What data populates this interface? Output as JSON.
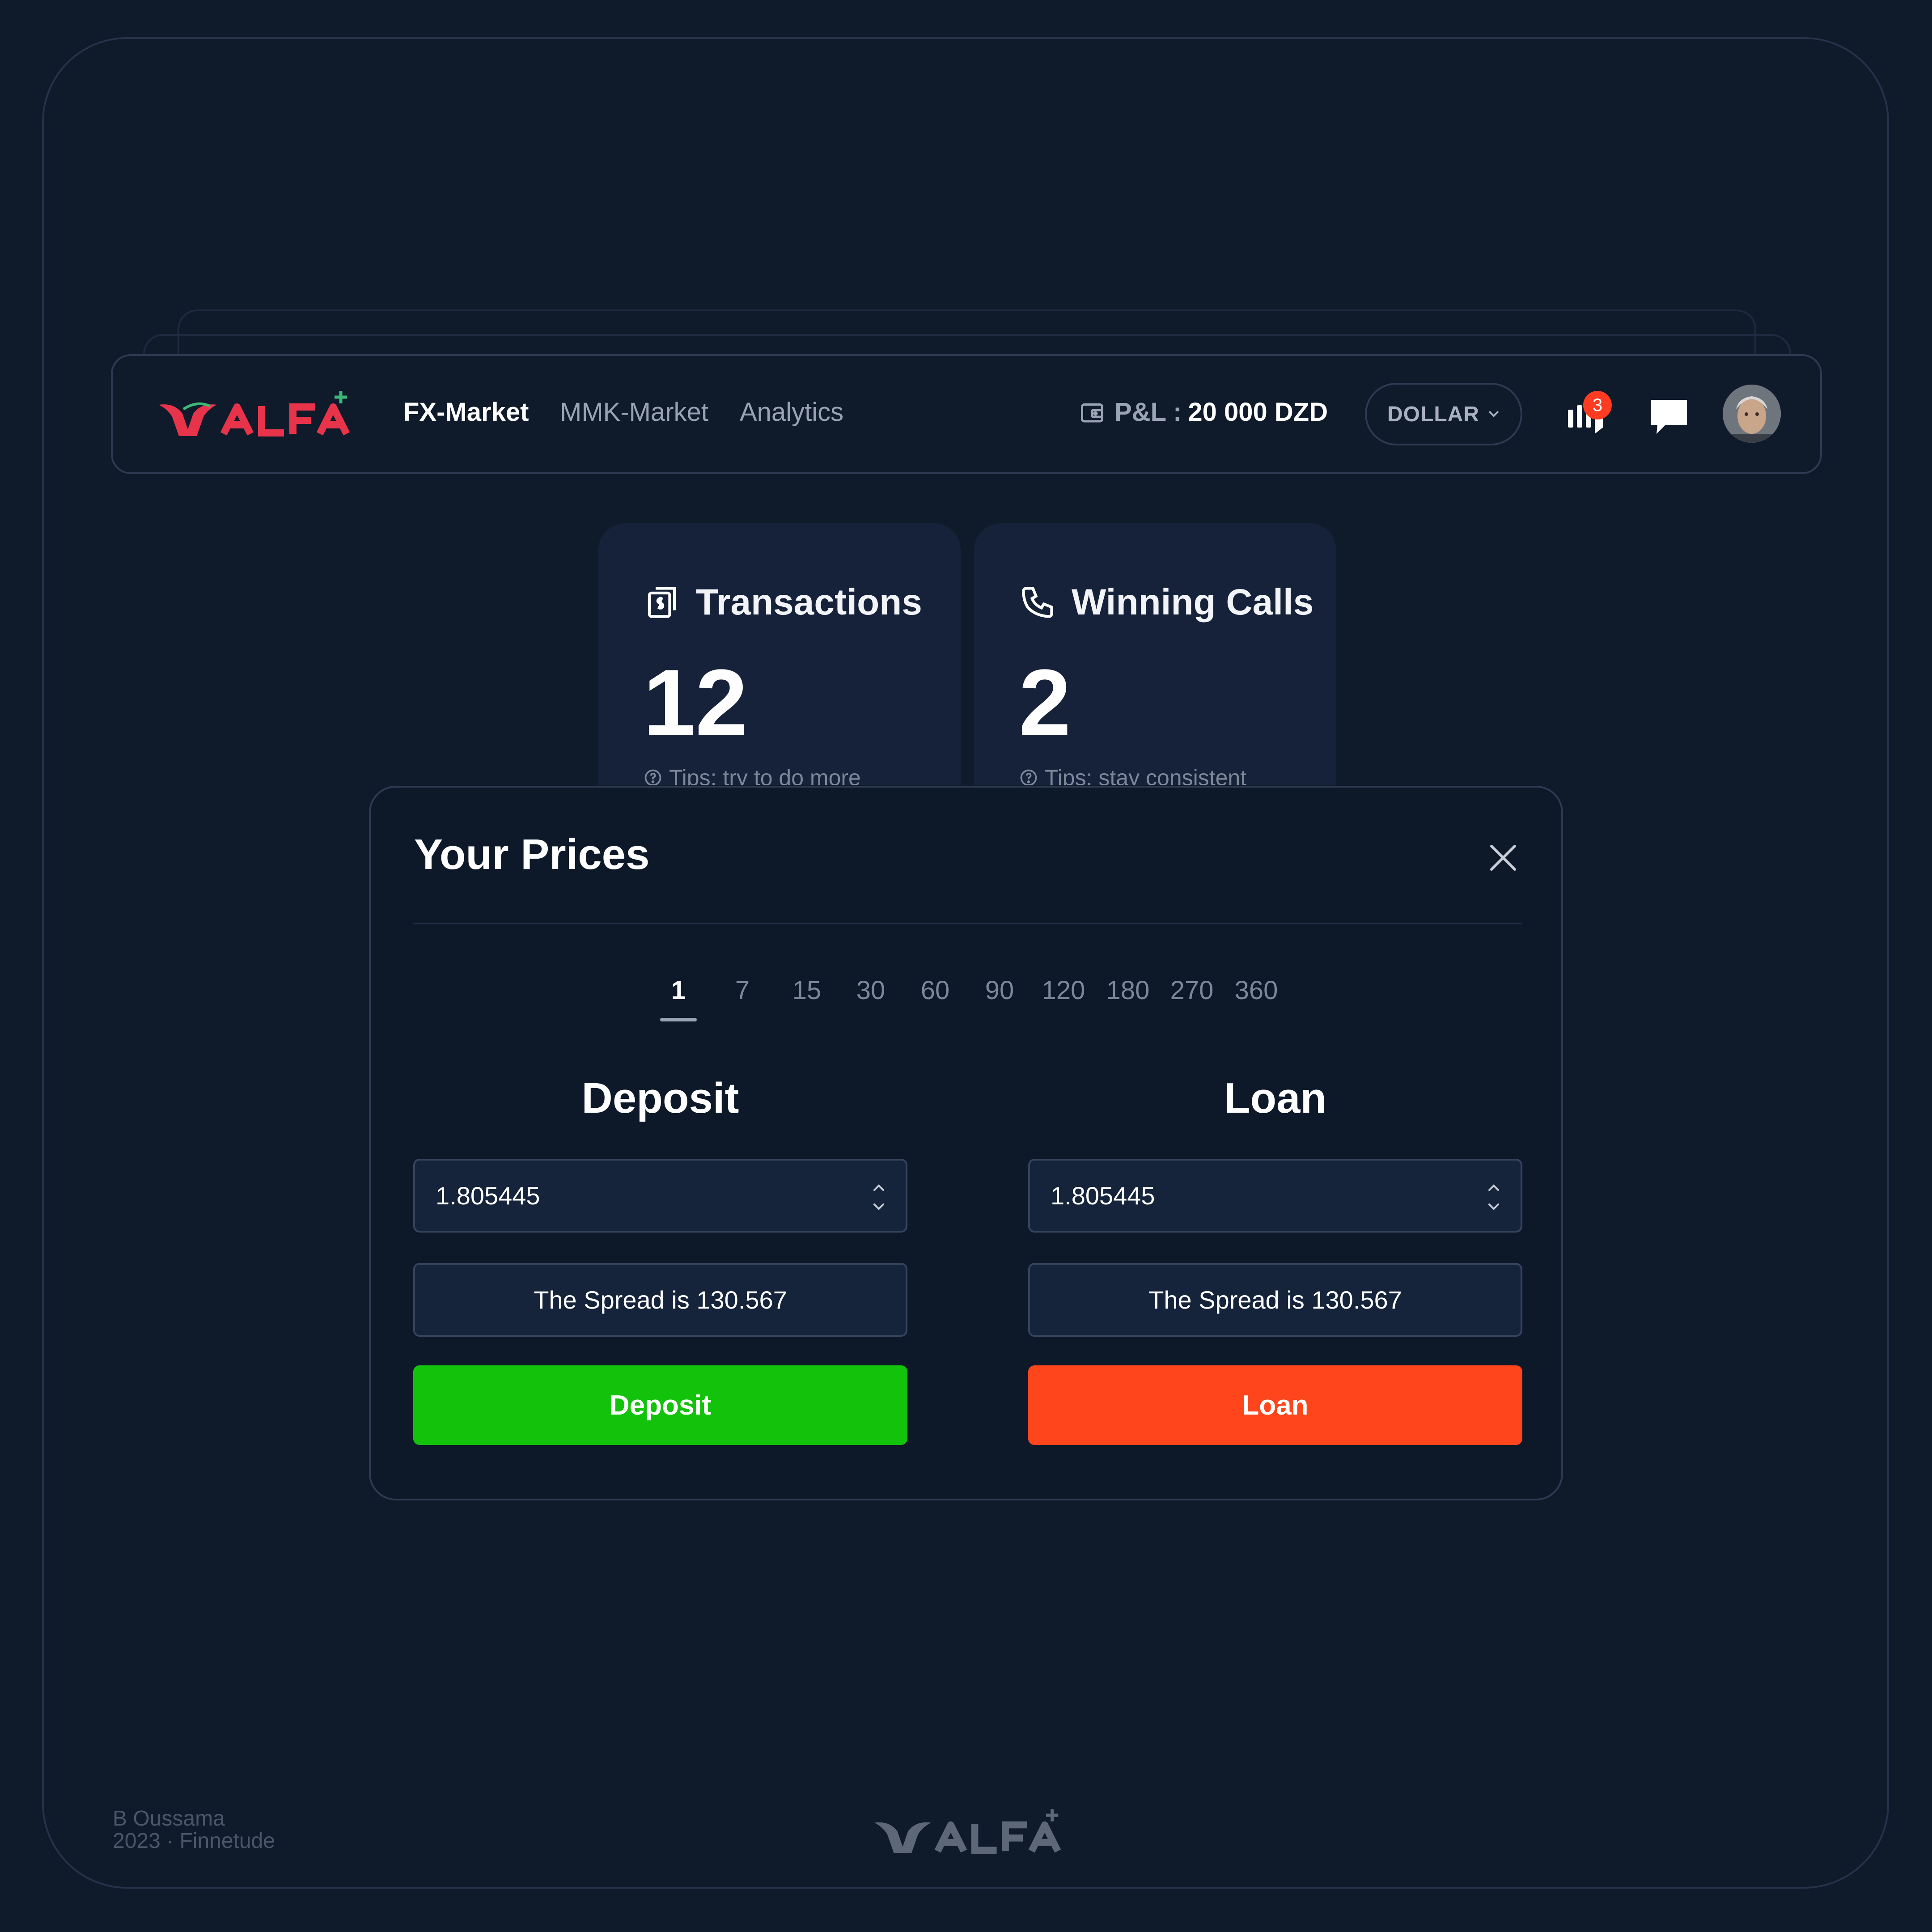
{
  "brand": {
    "name": "ALFA",
    "accent": "#e8344a",
    "plus_color": "#3cb878"
  },
  "nav": {
    "links": [
      {
        "label": "FX-Market",
        "active": true
      },
      {
        "label": "MMK-Market",
        "active": false
      },
      {
        "label": "Analytics",
        "active": false
      }
    ]
  },
  "header": {
    "pl_label": "P&L :",
    "pl_value": "20 000 DZD",
    "currency": "DOLLAR",
    "notifications_count": "3",
    "icons": [
      "wallet-icon",
      "chart-bars-icon",
      "chat-icon",
      "avatar"
    ]
  },
  "stats": [
    {
      "title": "Transactions",
      "value": "12",
      "tip": "Tips: try to do more",
      "icon": "receipt-dollar-icon"
    },
    {
      "title": "Winning Calls",
      "value": "2",
      "tip": "Tips: stay consistent",
      "icon": "phone-icon"
    }
  ],
  "modal": {
    "title": "Your Prices",
    "periods": [
      "1",
      "7",
      "15",
      "30",
      "60",
      "90",
      "120",
      "180",
      "270",
      "360"
    ],
    "selected_period": "1",
    "deposit": {
      "title": "Deposit",
      "price": "1.805445",
      "spread": "The Spread is 130.567",
      "button": "Deposit",
      "color": "#13c20b"
    },
    "loan": {
      "title": "Loan",
      "price": "1.805445",
      "spread": "The Spread is 130.567",
      "button": "Loan",
      "color": "#ff451b"
    }
  },
  "footer": {
    "author": "B Oussama",
    "year_org": "2023 · Finnetude"
  }
}
